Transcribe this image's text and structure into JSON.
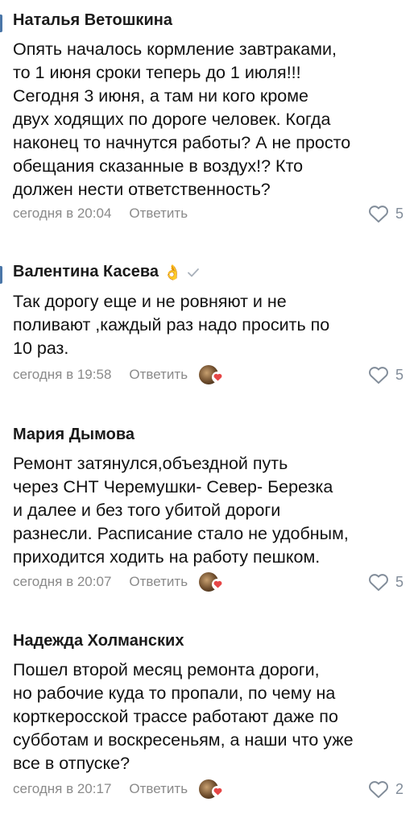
{
  "colors": {
    "accent": "#4a76a8",
    "meta_text": "#8a8a8a",
    "heart_outline": "#818c99",
    "heart_badge": "#e64646"
  },
  "comments": [
    {
      "author": "Наталья Ветошкина",
      "text": "Опять началось кормление завтраками,\nто 1 июня сроки теперь до 1 июля!!!\nСегодня 3 июня, а там ни кого кроме\nдвух ходящих по дороге человек. Когда\nнаконец то начнутся работы? А не просто\nобещания сказанные в воздух!? Кто\nдолжен нести ответственность?",
      "date": "сегодня в 20:04",
      "reply_label": "Ответить",
      "likes": "5"
    },
    {
      "author": "Валентина Касева",
      "emoji": "👌",
      "text": "Так дорогу еще и не ровняют и не\nполивают ,каждый раз надо просить по\n10 раз.",
      "date": "сегодня в 19:58",
      "reply_label": "Ответить",
      "likes": "5"
    },
    {
      "author": "Мария Дымова",
      "text": "Ремонт затянулся,объездной путь\nчерез СНТ Черемушки- Север- Березка\nи далее и без того убитой дороги\nразнесли. Расписание стало не удобным,\nприходится ходить на работу пешком.",
      "date": "сегодня в 20:07",
      "reply_label": "Ответить",
      "likes": "5"
    },
    {
      "author": "Надежда Холманских",
      "text": "Пошел второй месяц ремонта дороги,\nно рабочие куда то пропали, по чему на\nкорткеросской трассе работают даже по\nсубботам и воскресеньям, а наши что уже\nвсе в отпуске?",
      "date": "сегодня в 20:17",
      "reply_label": "Ответить",
      "likes": "2"
    }
  ]
}
